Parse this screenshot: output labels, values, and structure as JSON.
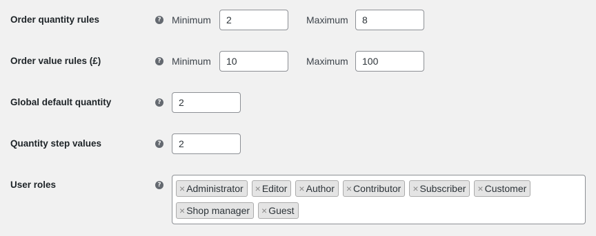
{
  "settings": {
    "order_quantity": {
      "label": "Order quantity rules",
      "help_icon": "question-circle-icon",
      "min_label": "Minimum",
      "min_value": "2",
      "max_label": "Maximum",
      "max_value": "8"
    },
    "order_value": {
      "label": "Order value rules (£)",
      "help_icon": "question-circle-icon",
      "min_label": "Minimum",
      "min_value": "10",
      "max_label": "Maximum",
      "max_value": "100"
    },
    "global_default_quantity": {
      "label": "Global default quantity",
      "help_icon": "question-circle-icon",
      "value": "2"
    },
    "quantity_step": {
      "label": "Quantity step values",
      "help_icon": "question-circle-icon",
      "value": "2"
    },
    "user_roles": {
      "label": "User roles",
      "help_icon": "question-circle-icon",
      "remove_glyph": "×",
      "selected": [
        "Administrator",
        "Editor",
        "Author",
        "Contributor",
        "Subscriber",
        "Customer",
        "Shop manager",
        "Guest"
      ]
    }
  },
  "help_glyph": "?"
}
